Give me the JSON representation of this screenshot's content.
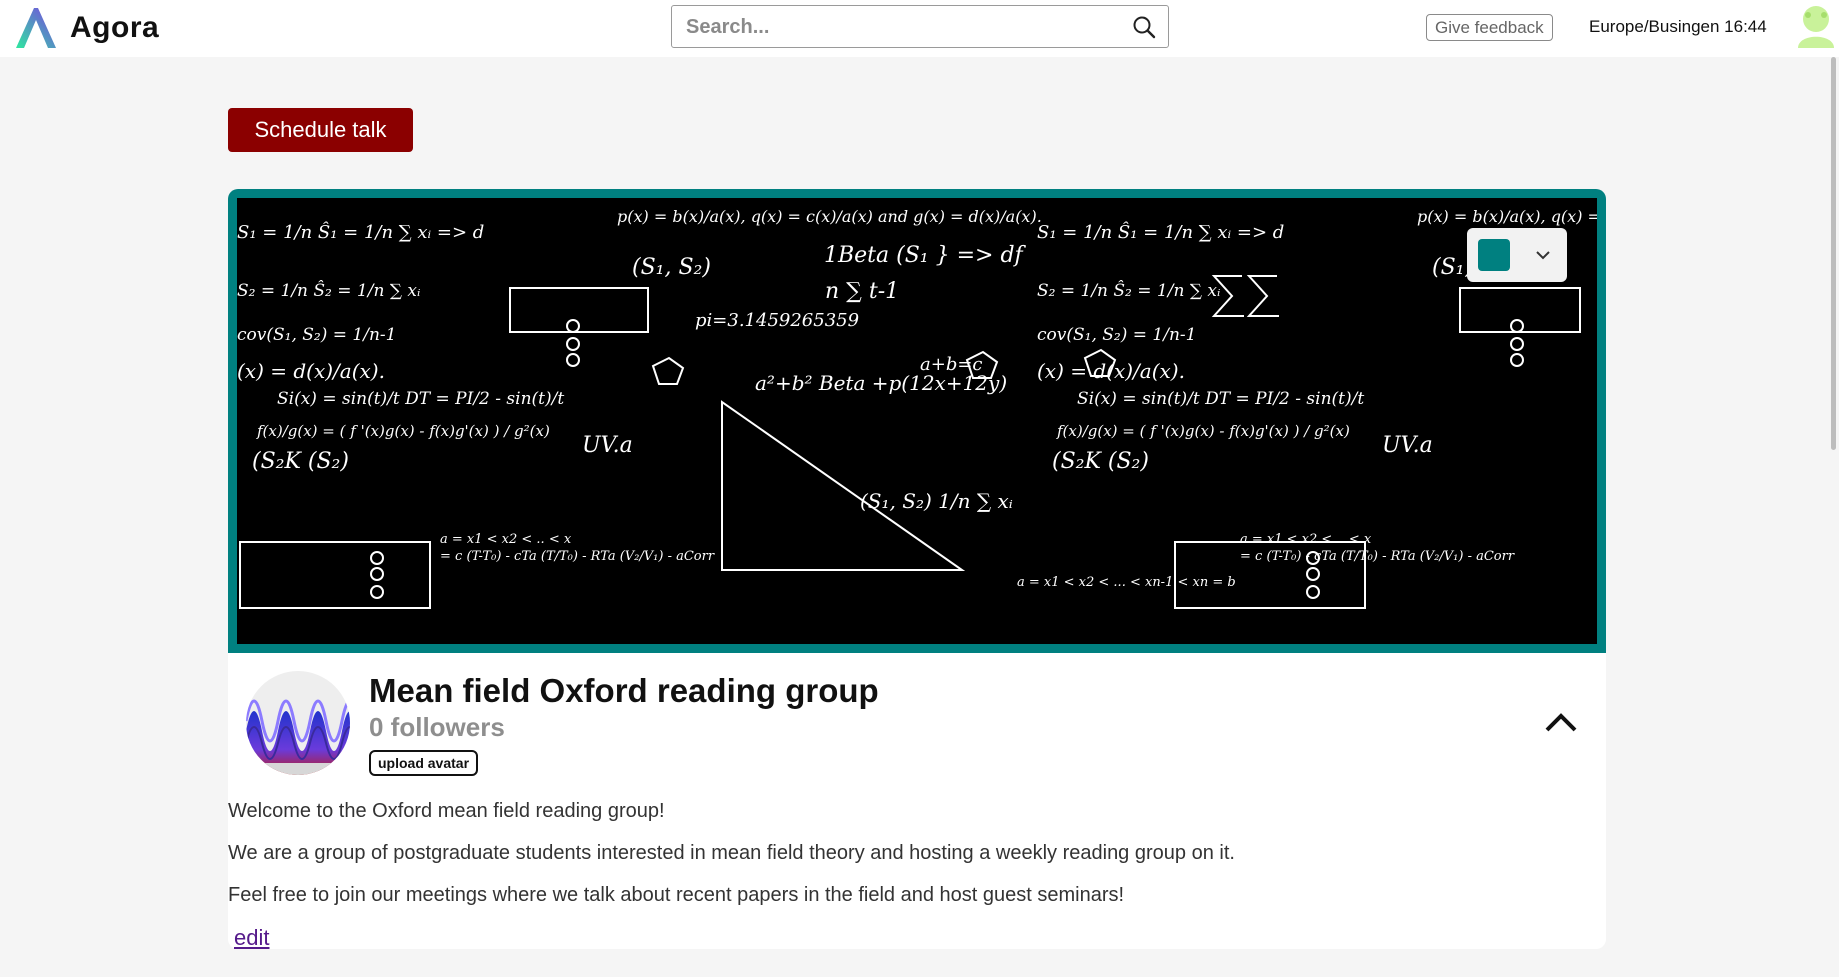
{
  "header": {
    "brand_name": "Agora",
    "search_placeholder": "Search...",
    "feedback_label": "Give feedback",
    "timezone_time": "Europe/Busingen 16:44"
  },
  "actions": {
    "schedule_label": "Schedule talk"
  },
  "banner": {
    "theme_color": "#008080",
    "equations": [
      "p(x) = b(x)/a(x), q(x) = c(x)/a(x) and g(x) = d(x)/a(x).",
      "S₁ = 1/n  Ŝ₁ = 1/n  ∑ xᵢ  => d",
      "S₂ = 1/n  Ŝ₂ = 1/n  ∑ xᵢ",
      "(S₁, S₂)",
      "1Beta (S₁ } => df",
      "n ∑ t-1",
      "pi=3.1459265359",
      "cov(S₁, S₂) = 1/n-1",
      "(x) = d(x)/a(x).",
      "Si(x) = sin(t)/t DT = PI/2 - sin(t)/t",
      "f(x)/g(x) = ( f '(x)g(x) - f(x)g'(x) ) / g²(x)",
      "UV.a",
      "(S₂K (S₂)",
      "a²+b² Beta +p(12x+12y)",
      "a+b=c",
      "a = x1 < x2 < .. < x",
      "= c (T-T₀) - cTa (T/T₀) - RTa (V₂/V₁) - aCorr",
      "(S₁, S₂)  1/n ∑ xᵢ",
      "a = x1 < x2 < ... < xn-1 < xn = b"
    ]
  },
  "group": {
    "title": "Mean field Oxford reading group",
    "followers": "0 followers",
    "upload_avatar_label": "upload avatar",
    "description": [
      "Welcome to the Oxford mean field reading group!",
      "We are a group of postgraduate students interested in mean field theory and hosting a weekly reading group on it.",
      "Feel free to join our meetings where we talk about recent papers in the field and host guest seminars!"
    ],
    "edit_label": "edit"
  },
  "icons": {
    "search": "search-icon",
    "chevron_down": "chevron-down-icon",
    "chevron_up": "chevron-up-icon",
    "user_avatar": "user-avatar-icon"
  },
  "colors": {
    "brand_purple": "#7b3fe4",
    "brand_green": "#2ee8a0",
    "schedule_red": "#8b0000",
    "teal": "#008080",
    "link_purple": "#551a8b"
  }
}
